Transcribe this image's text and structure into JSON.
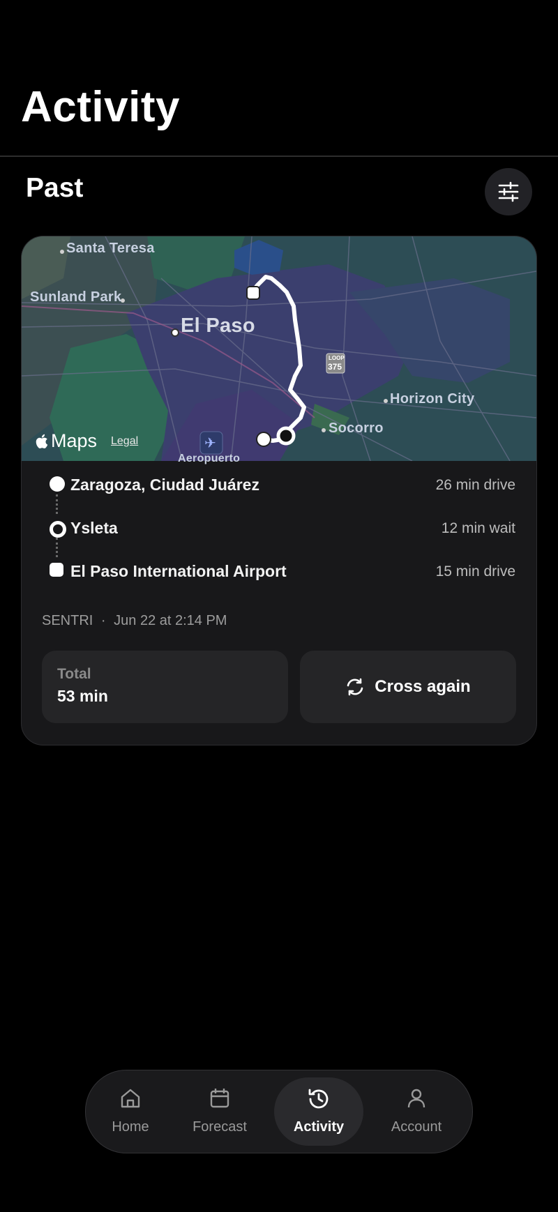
{
  "header": {
    "title": "Activity"
  },
  "section": {
    "title": "Past",
    "filter_icon": "sliders-icon"
  },
  "map": {
    "labels": {
      "santa_teresa": "Santa Teresa",
      "sunland_park": "Sunland Park",
      "el_paso": "El Paso",
      "horizon_city": "Horizon City",
      "socorro": "Socorro",
      "aeropuerto": "Aeropuerto",
      "loop_top": "LOOP",
      "loop_num": "375"
    },
    "attribution": "Maps",
    "legal": "Legal"
  },
  "trip": {
    "stops": [
      {
        "name": "Zaragoza, Ciudad Juárez",
        "meta": "26 min drive",
        "marker": "dot"
      },
      {
        "name": "Ysleta",
        "meta": "12 min wait",
        "marker": "ring"
      },
      {
        "name": "El Paso International Airport",
        "meta": "15 min drive",
        "marker": "square"
      }
    ],
    "program": "SENTRI",
    "separator": "·",
    "datetime": "Jun 22 at 2:14 PM",
    "total_label": "Total",
    "total_value": "53 min",
    "action_label": "Cross again",
    "action_icon": "refresh-icon"
  },
  "tabbar": {
    "tabs": [
      {
        "label": "Home",
        "icon": "home-icon",
        "active": false
      },
      {
        "label": "Forecast",
        "icon": "calendar-icon",
        "active": false
      },
      {
        "label": "Activity",
        "icon": "history-icon",
        "active": true
      },
      {
        "label": "Account",
        "icon": "person-icon",
        "active": false
      }
    ]
  },
  "colors": {
    "background": "#000000",
    "card": "#18181a",
    "map_water": "#2a4a6a",
    "route": "#ffffff"
  }
}
